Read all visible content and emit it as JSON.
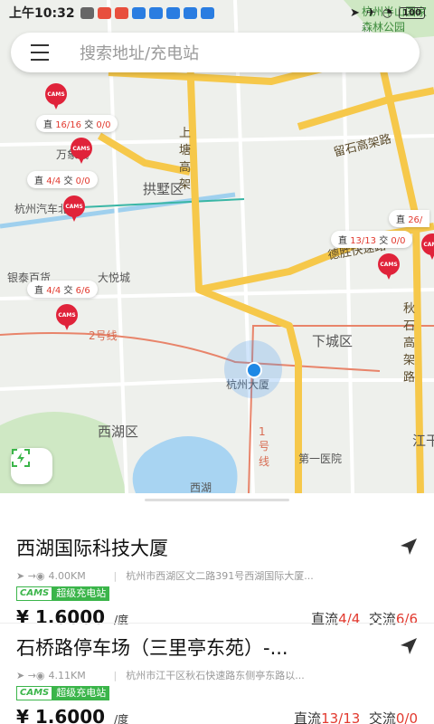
{
  "status_bar": {
    "time": "上午10:32",
    "battery": "100",
    "map_corner_text": "杭州半山国家森林公园"
  },
  "search": {
    "placeholder": "搜索地址/充电站"
  },
  "map": {
    "district_labels": [
      "拱墅区",
      "下城区",
      "西湖区"
    ],
    "road_labels": [
      "留石高架路",
      "德胜快速路",
      "秋石高架路",
      "上塘高架",
      "2号线",
      "1号线"
    ],
    "place_labels": [
      "杭州大厦",
      "万象城",
      "杭州汽车北站",
      "银泰百货",
      "大悦城",
      "第一医院",
      "西湖",
      "江干"
    ],
    "station_tags": [
      {
        "dc": "16/16",
        "ac": "0/0"
      },
      {
        "dc": "4/4",
        "ac": "0/0"
      },
      {
        "dc": "13/13",
        "ac": "0/0"
      },
      {
        "dc": "4/4",
        "ac": "6/6"
      },
      {
        "dc": "26/",
        "ac": ""
      }
    ],
    "tag_labels": {
      "dc": "直",
      "ac": "交"
    },
    "pin_text": "CAMS"
  },
  "stations": [
    {
      "name": "西湖国际科技大厦",
      "distance": "4.00KM",
      "address": "杭州市西湖区文二路391号西湖国际大厦...",
      "cams_label": "CAMS",
      "super_label": "超级充电站",
      "price": "¥ 1.6000",
      "unit": "/度",
      "dc_label": "直流",
      "dc_value": "4/4",
      "ac_label": "交流",
      "ac_value": "6/6"
    },
    {
      "name": "石桥路停车场（三里亭东苑）-...",
      "distance": "4.11KM",
      "address": "杭州市江干区秋石快速路东侧亭东路以...",
      "cams_label": "CAMS",
      "super_label": "超级充电站",
      "price": "¥ 1.6000",
      "unit": "/度",
      "dc_label": "直流",
      "dc_value": "13/13",
      "ac_label": "交流",
      "ac_value": "0/0"
    }
  ]
}
